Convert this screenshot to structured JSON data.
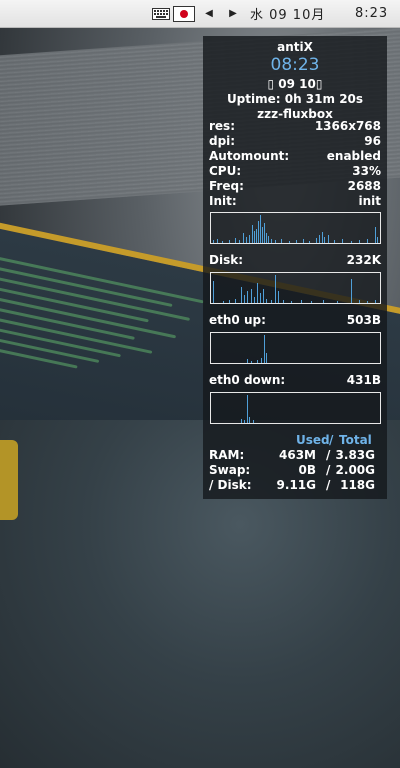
{
  "panel": {
    "keyboard_icon": "keyboard-icon",
    "flag_icon": "japan-flag-icon",
    "prev_glyph": "◀",
    "next_glyph": "▶",
    "date": "水 09 10月",
    "time": "8:23"
  },
  "conky": {
    "hostname": "antiX",
    "clock": "08:23",
    "date": " 09 10",
    "uptime": "Uptime: 0h 31m 20s",
    "window_manager": "zzz-fluxbox",
    "stats": [
      {
        "label": "res:",
        "value": "1366x768"
      },
      {
        "label": "dpi:",
        "value": "96"
      },
      {
        "label": "Automount:",
        "value": "enabled"
      },
      {
        "label": "CPU:",
        "value": "33%"
      },
      {
        "label": "Freq:",
        "value": "2688"
      },
      {
        "label": "Init:",
        "value": "init"
      }
    ],
    "disk": {
      "label": "Disk:",
      "value": "232K"
    },
    "eth0_up": {
      "label": "eth0 up:",
      "value": "503B"
    },
    "eth0_down": {
      "label": "eth0 down:",
      "value": "431B"
    },
    "usage_header": {
      "used": "Used",
      "slash": "/",
      "total": "Total"
    },
    "memory": [
      {
        "label": "RAM:",
        "used": "463M",
        "sep": "/",
        "total": "3.83G"
      },
      {
        "label": "Swap:",
        "used": "0B",
        "sep": "/",
        "total": "2.00G"
      },
      {
        "label": "/ Disk:",
        "used": "9.11G",
        "sep": "/",
        "total": "118G"
      }
    ],
    "graph_color": "#4f9fd8"
  }
}
